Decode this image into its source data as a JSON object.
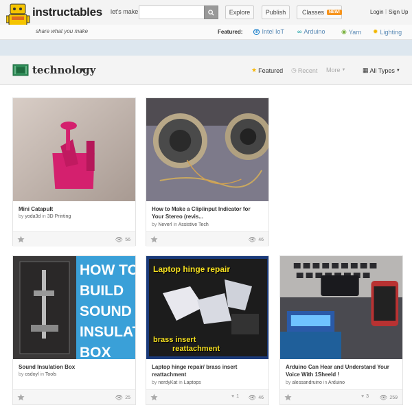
{
  "header": {
    "logo_text": "instructables",
    "tagline": "share what you make",
    "lets_make": "let's make",
    "search_placeholder": "",
    "nav": {
      "explore": "Explore",
      "publish": "Publish",
      "classes": "Classes",
      "classes_badge": "NEW!"
    },
    "login": "Login",
    "separator": "|",
    "signup": "Sign Up"
  },
  "featured": {
    "label": "Featured:",
    "items": [
      {
        "label": "Intel IoT",
        "icon": "intel-icon"
      },
      {
        "label": "Arduino",
        "icon": "arduino-icon"
      },
      {
        "label": "Yarn",
        "icon": "yarn-icon"
      },
      {
        "label": "Lighting",
        "icon": "lightbulb-icon"
      }
    ]
  },
  "category": {
    "title": "technology",
    "filters": {
      "featured": "Featured",
      "recent": "Recent",
      "more": "More",
      "all_types": "All Types"
    }
  },
  "cards": [
    {
      "title": "Mini Catapult",
      "title2": "",
      "by": "by",
      "author": "yoda3d",
      "in": "in",
      "category": "3D Printing",
      "likes": "",
      "views": "56"
    },
    {
      "title": "How to Make a Clip/input Indicator for",
      "title2": "Your Stereo (revis...",
      "by": "by",
      "author": "Neverl",
      "in": "in",
      "category": "Assistive Tech",
      "likes": "",
      "views": "46"
    },
    {
      "title": "Sound Insulation Box",
      "title2": "",
      "by": "by",
      "author": "osdoyl",
      "in": "in",
      "category": "Tools",
      "likes": "",
      "views": "25",
      "img_text": [
        "HOW TO",
        "BUILD",
        "SOUND",
        "INSULAT",
        "BOX"
      ]
    },
    {
      "title": "Laptop hinge repair/ brass insert",
      "title2": "reattachment",
      "by": "by",
      "author": "nerdyKat",
      "in": "in",
      "category": "Laptops",
      "likes": "1",
      "views": "46",
      "img_text": [
        "Laptop hinge repair",
        "brass insert",
        "reattachment"
      ]
    },
    {
      "title": "Arduino Can Hear and Understand Your",
      "title2": "Voice With 1Sheeld !",
      "by": "by",
      "author": "alessandruino",
      "in": "in",
      "category": "Arduino",
      "likes": "3",
      "views": "259"
    }
  ],
  "colors": {
    "accent": "#f7941d",
    "link": "#5a8ab5",
    "band": "#dde7ef",
    "tech_green": "#2e8b57"
  }
}
